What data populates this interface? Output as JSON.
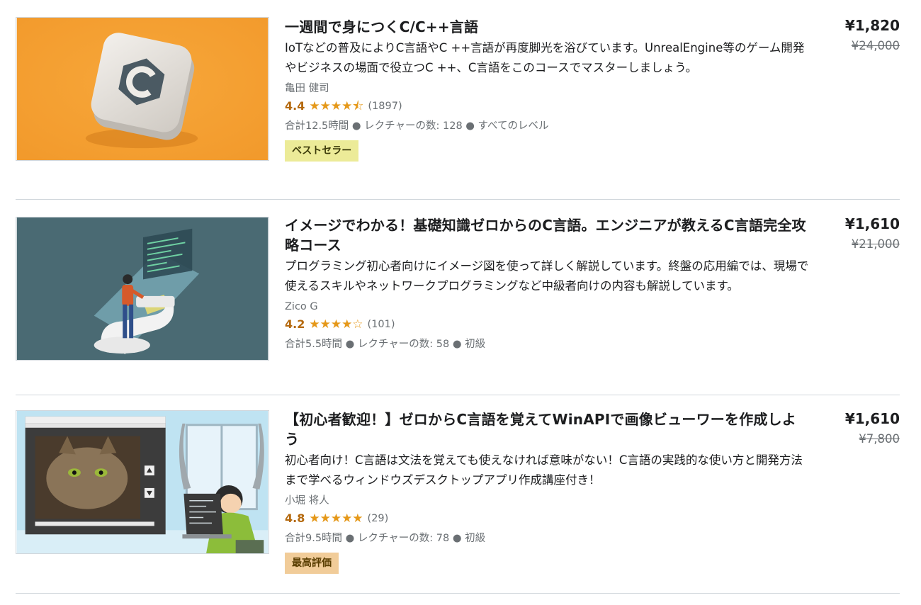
{
  "courses": [
    {
      "title": "一週間で身につくC/C++言語",
      "desc": "IoTなどの普及によりC言語やC ++言語が再度脚光を浴びています。UnrealEngine等のゲーム開発やビジネスの場面で役立つC ++、C言語をこのコースでマスターしましょう。",
      "author": "亀田 健司",
      "rating": "4.4",
      "stars": "★★★★⯪",
      "count": "(1897)",
      "meta": "合計12.5時間 ● レクチャーの数: 128 ● すべてのレベル",
      "badge": "ベストセラー",
      "price": "¥1,820",
      "old_price": "¥24,000",
      "thumb_icon": "c-language-key-icon"
    },
    {
      "title": "イメージでわかる！基礎知識ゼロからのC言語。エンジニアが教えるC言語完全攻略コース",
      "desc": "プログラミング初心者向けにイメージ図を使って詳しく解説しています。終盤の応用編では、現場で使えるスキルやネットワークプログラミングなど中級者向けの内容も解説しています。",
      "author": "Zico G",
      "rating": "4.2",
      "stars": "★★★★☆",
      "count": "(101)",
      "meta": "合計5.5時間 ● レクチャーの数: 58 ● 初級",
      "price": "¥1,610",
      "old_price": "¥21,000",
      "thumb_icon": "engineer-hologram-icon"
    },
    {
      "title": "【初心者歓迎！】ゼロからC言語を覚えてWinAPIで画像ビューワーを作成しよう",
      "desc": "初心者向け！C言語は文法を覚えても使えなければ意味がない！C言語の実践的な使い方と開発方法まで学べるウィンドウズデスクトップアプリ作成講座付き！",
      "author": "小堀 将人",
      "rating": "4.8",
      "stars": "★★★★★",
      "count": "(29)",
      "meta": "合計9.5時間 ● レクチャーの数: 78 ● 初級",
      "badge": "最高評価",
      "price": "¥1,610",
      "old_price": "¥7,800",
      "thumb_icon": "image-viewer-app-icon"
    }
  ],
  "colors": {
    "rating": "#b4690e",
    "star": "#e59819",
    "badge_best": "#eceb98",
    "badge_top": "#f9d29d",
    "muted": "#6a6f73",
    "divider": "#d1d7dc"
  }
}
